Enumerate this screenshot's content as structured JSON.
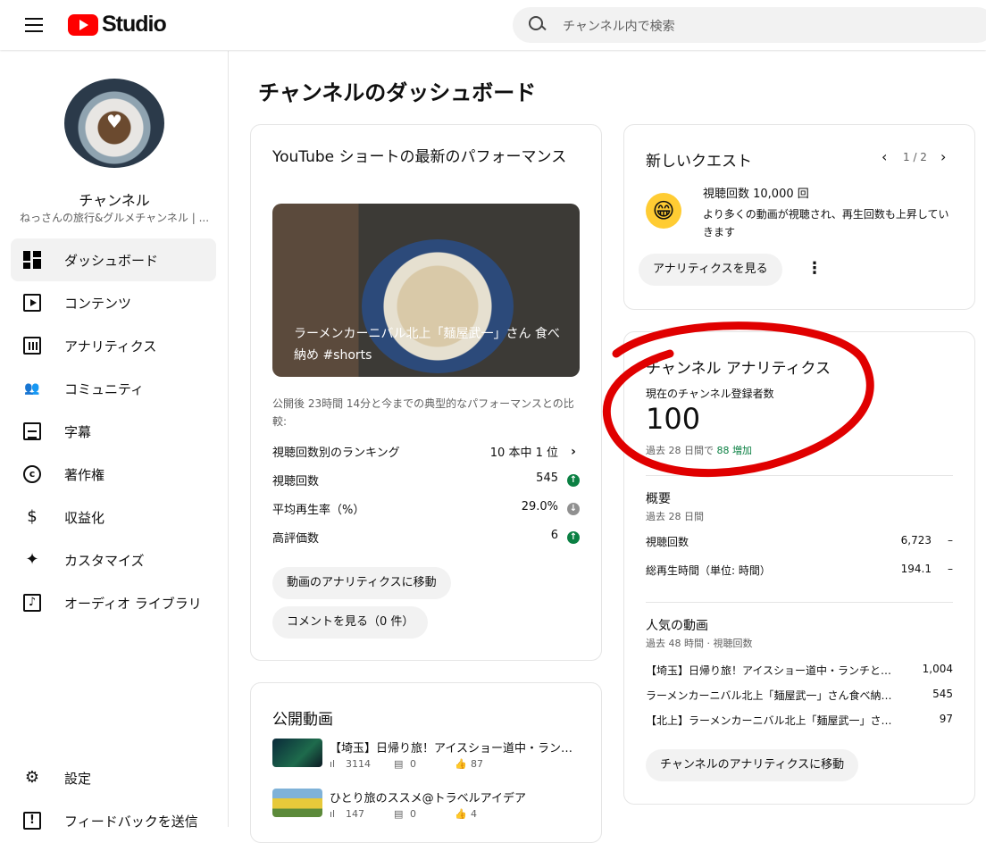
{
  "topbar": {
    "studio_word": "Studio",
    "search_placeholder": "チャンネル内で検索"
  },
  "sidebar": {
    "channel_title": "チャンネル",
    "channel_subtitle": "ねっさんの旅行&グルメチャンネル | ...",
    "items": [
      {
        "label": "ダッシュボード",
        "icon": "dashboard-icon"
      },
      {
        "label": "コンテンツ",
        "icon": "content-icon"
      },
      {
        "label": "アナリティクス",
        "icon": "analytics-icon"
      },
      {
        "label": "コミュニティ",
        "icon": "community-icon"
      },
      {
        "label": "字幕",
        "icon": "subtitles-icon"
      },
      {
        "label": "著作権",
        "icon": "copyright-icon"
      },
      {
        "label": "収益化",
        "icon": "monetization-icon"
      },
      {
        "label": "カスタマイズ",
        "icon": "customize-icon"
      },
      {
        "label": "オーディオ ライブラリ",
        "icon": "audio-library-icon"
      }
    ],
    "settings": "設定",
    "feedback": "フィードバックを送信"
  },
  "page_title": "チャンネルのダッシュボード",
  "shorts_card": {
    "title": "YouTube ショートの最新のパフォーマンス",
    "video_title": "ラーメンカーニバル北上「麺屋武一」さん 食べ納め #shorts",
    "summary": "公開後 23時間 14分と今までの典型的なパフォーマンスとの比較:",
    "rows": [
      {
        "label": "視聴回数別のランキング",
        "value": "10 本中 1 位",
        "indicator": "chevron"
      },
      {
        "label": "視聴回数",
        "value": "545",
        "indicator": "up"
      },
      {
        "label": "平均再生率（%）",
        "value": "29.0%",
        "indicator": "down"
      },
      {
        "label": "高評価数",
        "value": "6",
        "indicator": "up"
      }
    ],
    "btn_analytics": "動画のアナリティクスに移動",
    "btn_comments": "コメントを見る（0 件）"
  },
  "published_card": {
    "title": "公開動画",
    "videos": [
      {
        "title": "【埼玉】日帰り旅！アイスショー道中・ランチとお土産",
        "views": "3114",
        "comments": "0",
        "likes": "87"
      },
      {
        "title": "ひとり旅のススメ@トラベルアイデア",
        "views": "147",
        "comments": "0",
        "likes": "4"
      }
    ]
  },
  "quest_card": {
    "title": "新しいクエスト",
    "pager": "1 / 2",
    "headline": "視聴回数 10,000 回",
    "desc": "より多くの動画が視聴され、再生回数も上昇していきます",
    "btn": "アナリティクスを見る"
  },
  "analytics_card": {
    "title": "チャンネル アナリティクス",
    "subs_label": "現在のチャンネル登録者数",
    "subs_value": "100",
    "subs_change_prefix": "過去 28 日間で",
    "subs_change": "88 増加",
    "overview_title": "概要",
    "overview_period": "過去 28 日間",
    "stats": [
      {
        "label": "視聴回数",
        "value": "6,723",
        "trend": "–"
      },
      {
        "label": "総再生時間（単位: 時間）",
        "value": "194.1",
        "trend": "–"
      }
    ],
    "top_title": "人気の動画",
    "top_period": "過去 48 時間 · 視聴回数",
    "top_videos": [
      {
        "title": "【埼玉】日帰り旅！アイスショー道中・ランチと…",
        "value": "1,004"
      },
      {
        "title": "ラーメンカーニバル北上「麺屋武一」さん食べ納…",
        "value": "545"
      },
      {
        "title": "【北上】ラーメンカーニバル北上「麺屋武一」さ…",
        "value": "97"
      }
    ],
    "btn": "チャンネルのアナリティクスに移動"
  },
  "colors": {
    "accent_red": "#ff0000",
    "green": "#0b8043",
    "highlight_circle": "#e00000"
  }
}
